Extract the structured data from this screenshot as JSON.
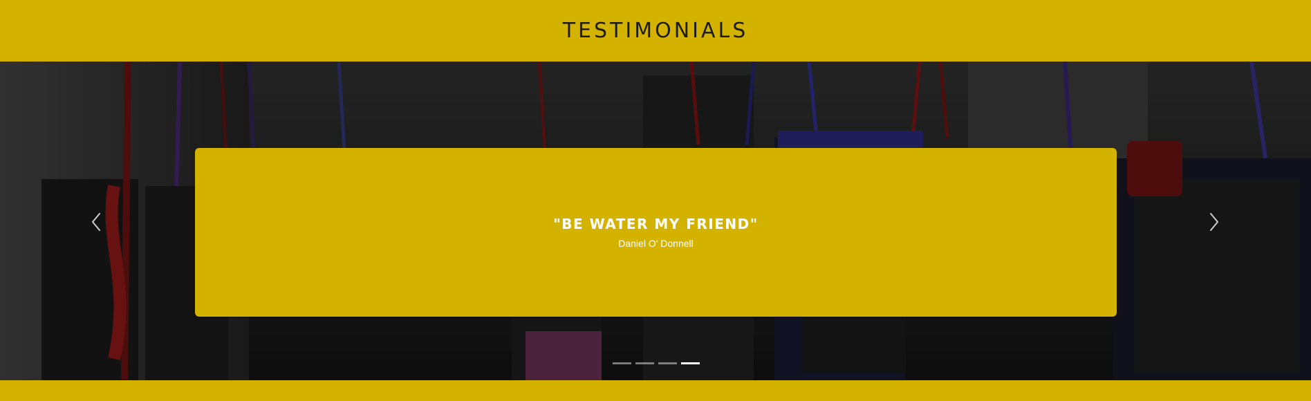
{
  "section": {
    "title": "TESTIMONIALS"
  },
  "slider": {
    "quote": "\"BE WATER MY FRIEND\"",
    "author": "Daniel O' Donnell",
    "prev_icon": "chevron-left-icon",
    "next_icon": "chevron-right-icon",
    "slide_count": 4,
    "active_slide": 4
  },
  "colors": {
    "accent": "#d4b200",
    "text_dark": "#1d1d1d",
    "text_light": "#ffffff"
  }
}
